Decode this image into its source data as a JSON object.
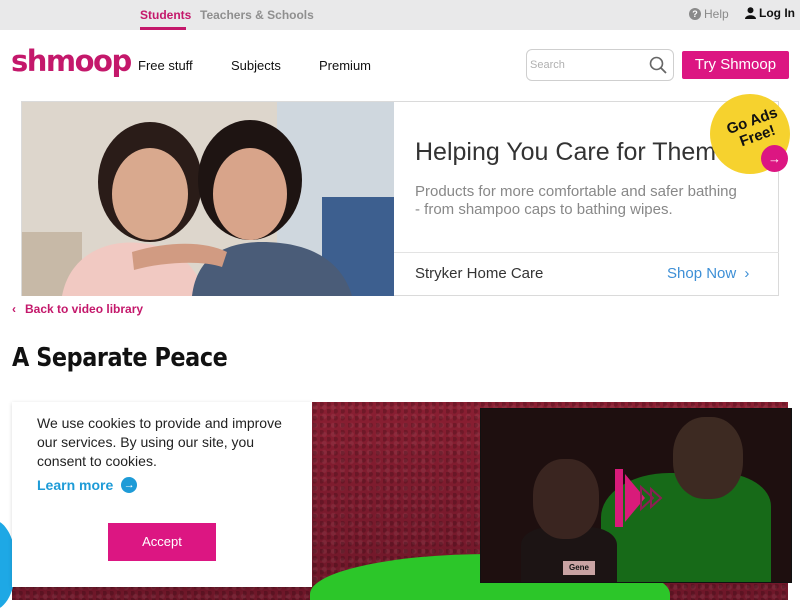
{
  "topbar": {
    "tabs": [
      {
        "label": "Students",
        "active": true
      },
      {
        "label": "Teachers & Schools",
        "active": false
      }
    ],
    "help_label": "Help",
    "login_label": "Log In"
  },
  "header": {
    "logo": "shmoop",
    "nav": [
      "Free stuff",
      "Subjects",
      "Premium"
    ],
    "search_placeholder": "Search",
    "cta_label": "Try Shmoop"
  },
  "ad": {
    "title": "Helping You Care for Them",
    "description": "Products for more comfortable and safer bathing - from shampoo caps to bathing wipes.",
    "brand": "Stryker Home Care",
    "cta": "Shop Now",
    "badge": "Go Ads Free!"
  },
  "back_link": "Back to video library",
  "page_title": "A Separate Peace",
  "video": {
    "name_tag": "Gene"
  },
  "cookie": {
    "text": "We use cookies to provide and improve our services. By using our site, you consent to cookies.",
    "learn_more": "Learn more",
    "accept": "Accept"
  },
  "colors": {
    "brand_pink": "#dc1682",
    "link_blue": "#1e9bd7",
    "badge_yellow": "#f6d22e"
  }
}
